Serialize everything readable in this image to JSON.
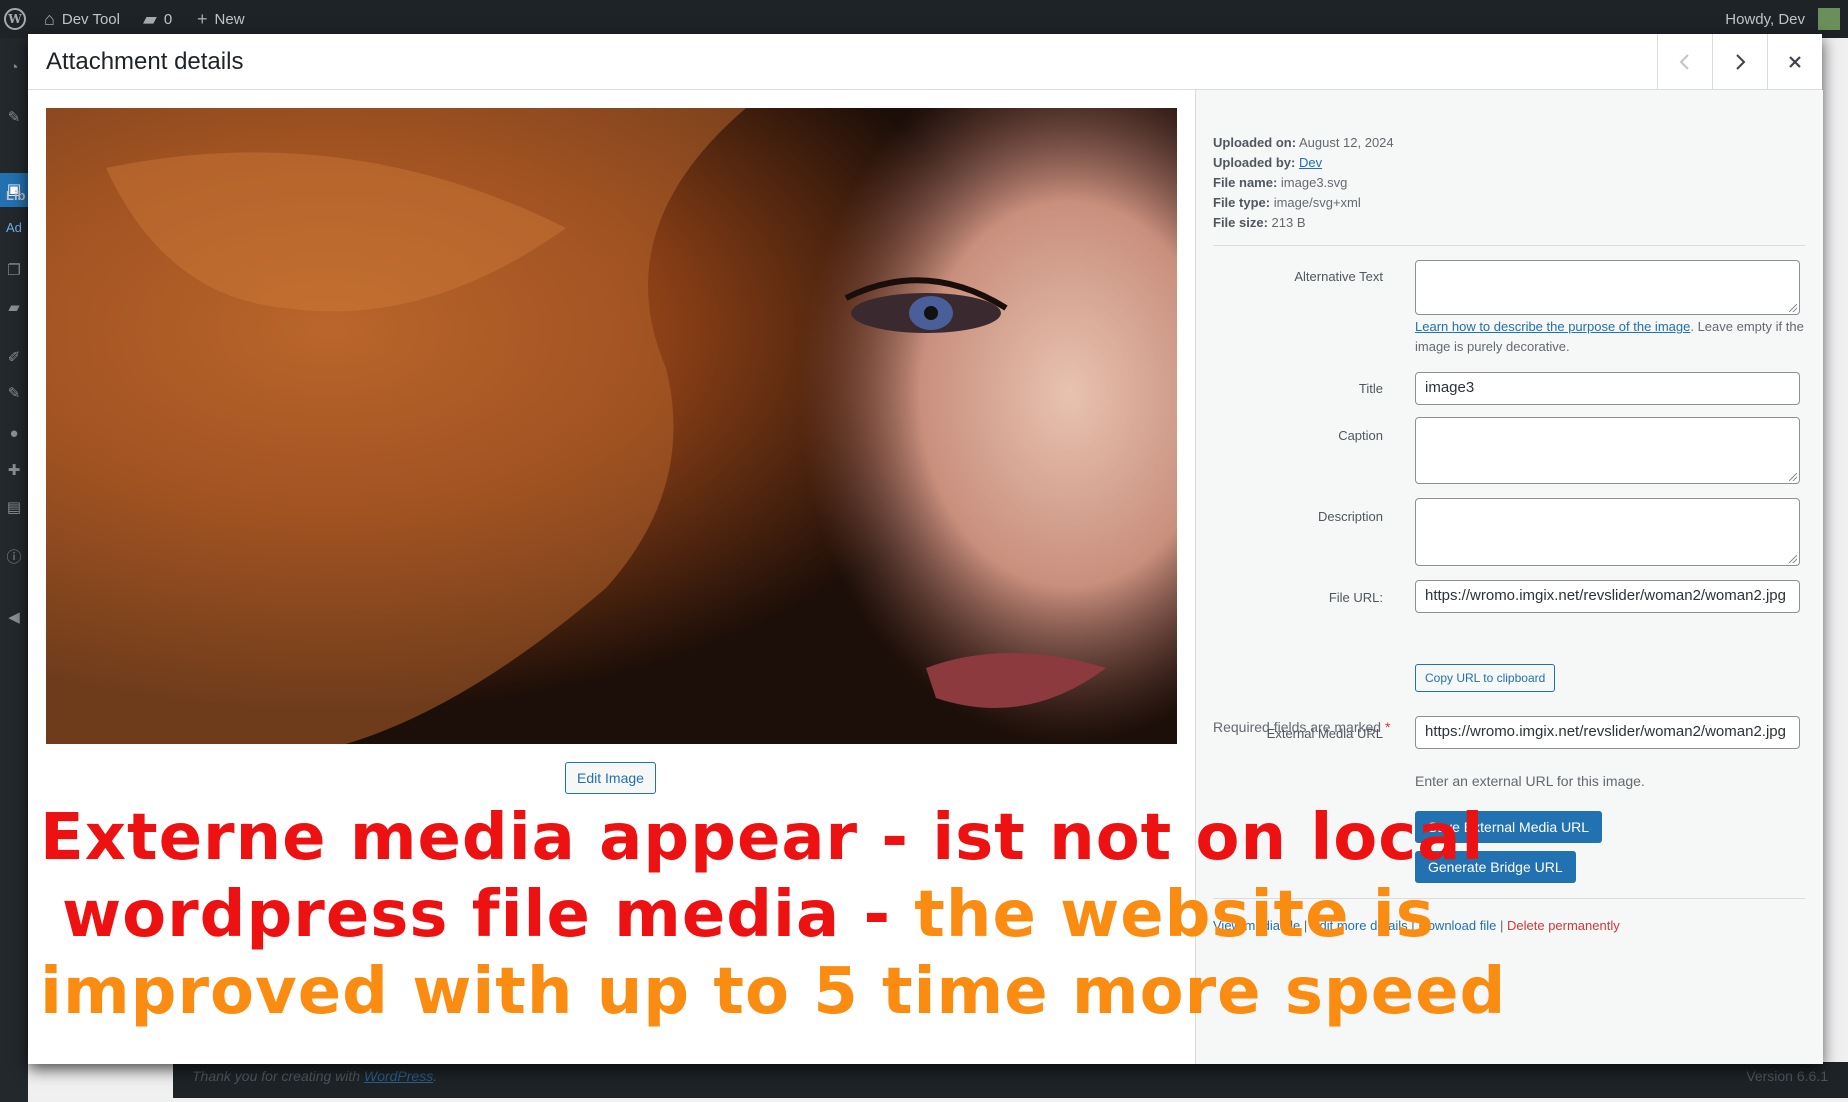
{
  "admin_bar": {
    "site_name": "Dev Tool",
    "comments_count": "0",
    "new_label": "New",
    "greeting": "Howdy, Dev"
  },
  "sidebar": {
    "partial_labels": [
      "Lib",
      "Ad"
    ]
  },
  "footer": {
    "thanks_prefix": "Thank you for creating with ",
    "thanks_link": "WordPress",
    "thanks_suffix": ".",
    "version": "Version 6.6.1"
  },
  "modal": {
    "title": "Attachment details",
    "edit_image_label": "Edit Image",
    "details": {
      "uploaded_on_label": "Uploaded on:",
      "uploaded_on": "August 12, 2024",
      "uploaded_by_label": "Uploaded by:",
      "uploaded_by": "Dev",
      "file_name_label": "File name:",
      "file_name": "image3.svg",
      "file_type_label": "File type:",
      "file_type": "image/svg+xml",
      "file_size_label": "File size:",
      "file_size": "213 B"
    },
    "fields": {
      "alt_label": "Alternative Text",
      "alt_value": "",
      "alt_help_link": "Learn how to describe the purpose of the image",
      "alt_help_text": ". Leave empty if the image is purely decorative.",
      "title_label": "Title",
      "title_value": "image3",
      "caption_label": "Caption",
      "caption_value": "",
      "description_label": "Description",
      "description_value": "",
      "file_url_label": "File URL:",
      "file_url_value": "https://wromo.imgix.net/revslider/woman2/woman2.jpg",
      "copy_url_label": "Copy URL to clipboard",
      "required_note": "Required fields are marked",
      "required_star": "*",
      "external_url_label": "External Media URL",
      "external_url_value": "https://wromo.imgix.net/revslider/woman2/woman2.jpg",
      "external_url_help": "Enter an external URL for this image."
    },
    "buttons": {
      "save_external": "Save External Media URL",
      "generate_bridge": "Generate Bridge URL"
    },
    "actions": {
      "view_media": "View media file",
      "edit_details": "Edit more details",
      "download": "Download file",
      "delete": "Delete permanently",
      "separator": "|"
    }
  },
  "overlay_caption": {
    "line1": "Externe media appear - ist not on local",
    "line2_red": "wordpress file media - ",
    "line2_orange": "the website is",
    "line3": "improved with up to 5 time more speed"
  },
  "colors": {
    "accent": "#2271b1",
    "caption_red": "#ee1111",
    "caption_orange": "#fb8c12",
    "danger": "#d63638"
  }
}
